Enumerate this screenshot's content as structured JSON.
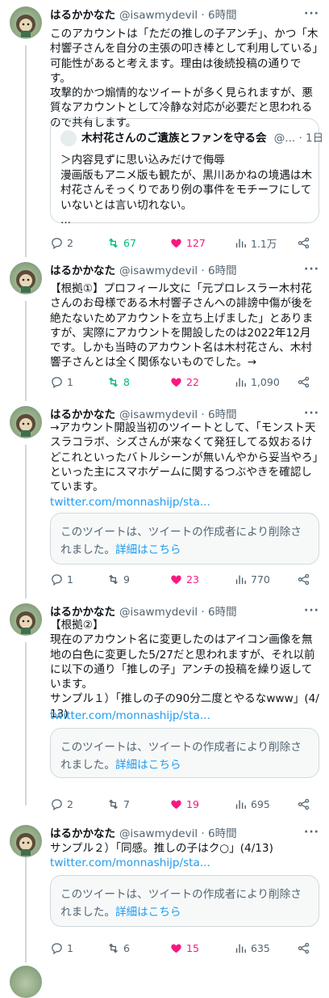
{
  "tweets": [
    {
      "name": "はるかかなた",
      "handle": "@isawmydevil · 6時間",
      "body": "このアカウントは「ただの推しの子アンチ」、かつ「木村響子さんを自分の主張の叩き棒として利用している」可能性があると考えます。理由は後続投稿の通りです。\n攻撃的かつ煽情的なツイートが多く見られますが、悪質なアカウントとして冷静な対応が必要だと思われるので共有します。",
      "quote": {
        "name": "木村花さんのご遺族とファンを守る会",
        "meta": "@... · 1日",
        "text": "＞内容見ずに思い込みだけで侮辱\n漫画版もアニメ版も観たが、黒川あかねの境遇は木村花さんそっくりであり例の事件をモチーフにしていないとは言い切れない。\n..."
      },
      "replies": "2",
      "retweets": "67",
      "likes": "127",
      "views": "1.1万"
    },
    {
      "name": "はるかかなた",
      "handle": "@isawmydevil · 6時間",
      "body": "【根拠①】プロフィール文に「元プロレスラー木村花さんのお母様である木村響子さんへの誹謗中傷が後を絶たないためアカウントを立ち上げました」とありますが、実際にアカウントを開設したのは2022年12月です。しかも当時のアカウント名は木村花さん、木村響子さんとは全く関係ないものでした。→",
      "replies": "1",
      "retweets": "8",
      "likes": "22",
      "views": "1,090"
    },
    {
      "name": "はるかかなた",
      "handle": "@isawmydevil · 6時間",
      "body": "→アカウント開設当初のツイートとして、「モンスト天スラコラボ、シズさんが来なくて発狂してる奴おるけどこれといったバトルシーンが無いんやから妥当やろ」といった主にスマホゲームに関するつぶやきを確認しています。",
      "link": "twitter.com/monnashijp/sta...",
      "deleted": {
        "text": "このツイートは、ツイートの作成者により削除されました。",
        "more": "詳細はこちら"
      },
      "replies": "1",
      "retweets": "9",
      "likes": "23",
      "views": "770"
    },
    {
      "name": "はるかかなた",
      "handle": "@isawmydevil · 6時間",
      "body": "【根拠②】\n現在のアカウント名に変更したのはアイコン画像を無地の白色に変更した5/27だと思われますが、それ以前に以下の通り「推しの子」アンチの投稿を繰り返しています。\nサンプル１）「推しの子の90分二度とやるなwww」(4/13)",
      "link": "twitter.com/monnashijp/sta...",
      "deleted": {
        "text": "このツイートは、ツイートの作成者により削除されました。",
        "more": "詳細はこちら"
      },
      "replies": "2",
      "retweets": "7",
      "likes": "19",
      "views": "695"
    },
    {
      "name": "はるかかなた",
      "handle": "@isawmydevil · 6時間",
      "body": "サンプル２）「同感。推しの子はク○」(4/13)",
      "link": "twitter.com/monnashijp/sta...",
      "deleted": {
        "text": "このツイートは、ツイートの作成者により削除されました。",
        "more": "詳細はこちら"
      },
      "replies": "1",
      "retweets": "6",
      "likes": "15",
      "views": "635"
    }
  ],
  "more_icon": "more-horizontal-icon",
  "colors": {
    "retweet": "#00ba7c",
    "like": "#f91880",
    "link": "#1d9bf0",
    "muted": "#536471"
  }
}
